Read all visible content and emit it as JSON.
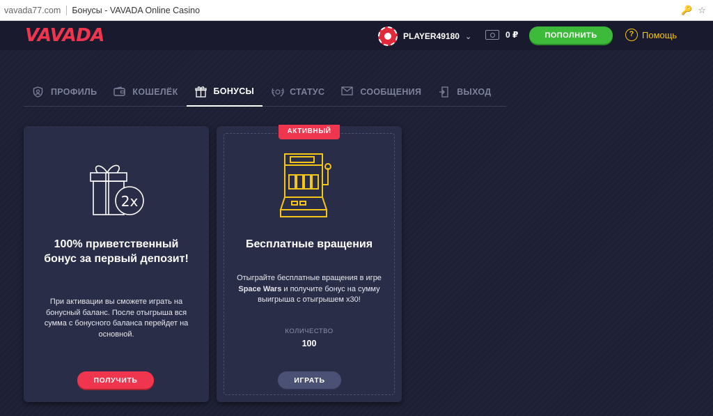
{
  "browser": {
    "domain": "vavada77.com",
    "page_title": "Бонусы - VAVADA Online Casino"
  },
  "header": {
    "logo": "VAVADA",
    "username": "PLAYER49180",
    "balance": "0 ₽",
    "deposit_label": "ПОПОЛНИТЬ",
    "help_label": "Помощь"
  },
  "tabs": [
    {
      "label": "ПРОФИЛЬ",
      "icon": "shield-user-icon"
    },
    {
      "label": "КОШЕЛЁК",
      "icon": "wallet-icon"
    },
    {
      "label": "БОНУСЫ",
      "icon": "gift-icon",
      "active": true
    },
    {
      "label": "СТАТУС",
      "icon": "laurel-icon"
    },
    {
      "label": "СООБЩЕНИЯ",
      "icon": "envelope-icon"
    },
    {
      "label": "ВЫХОД",
      "icon": "logout-icon"
    }
  ],
  "cards": [
    {
      "icon": "gift-2x-icon",
      "title_line1": "100% приветственный",
      "title_line2": "бонус за первый депозит!",
      "desc_line1": "При активации вы сможете играть на",
      "desc_line2": "бонусный баланс. После отыгрыша вся",
      "desc_line3": "сумма с бонусного баланса перейдет на",
      "desc_line4": "основной.",
      "button": "ПОЛУЧИТЬ"
    },
    {
      "badge": "АКТИВНЫЙ",
      "icon": "slot-machine-icon",
      "title": "Бесплатные вращения",
      "desc_line1": "Отыграйте бесплатные вращения в игре",
      "desc_game": "Space Wars",
      "desc_line2_rest": " и получите бонус на сумму",
      "desc_line3": "выигрыша с отыгрышем х30!",
      "qty_label": "КОЛИЧЕСТВО",
      "qty_value": "100",
      "button": "ИГРАТЬ"
    }
  ],
  "colors": {
    "accent_red": "#f0364e",
    "green": "#3dba3a",
    "yellow": "#f5c518",
    "card_bg": "#2a2d47",
    "page_bg": "#1d1f34"
  }
}
